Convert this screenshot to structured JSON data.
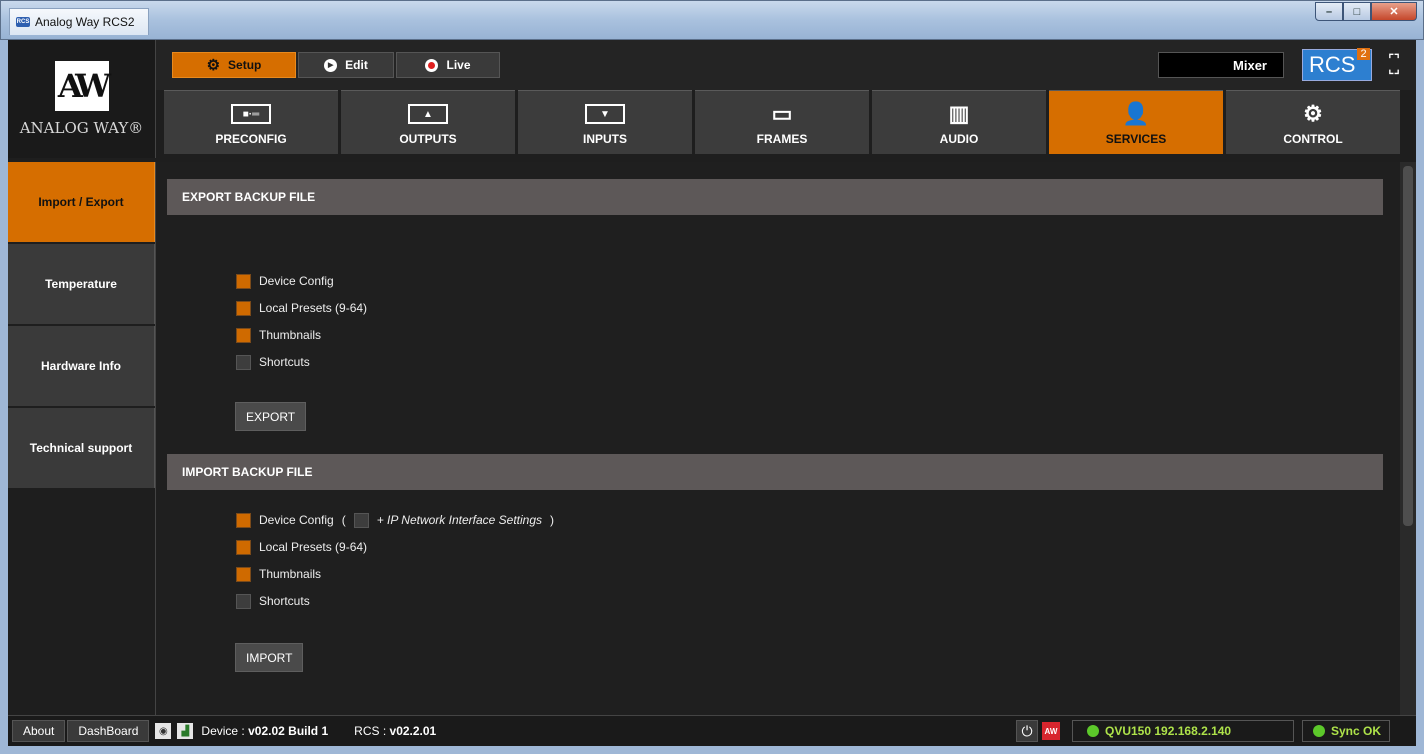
{
  "window": {
    "title": "Analog Way RCS2",
    "icon_text": "RCS",
    "controls": [
      "–",
      "□",
      "✕"
    ]
  },
  "logo": {
    "mark": "AW",
    "brand": "ANALOG WAY®"
  },
  "modes": [
    {
      "label": "Setup",
      "icon": "gear-icon"
    },
    {
      "label": "Edit",
      "icon": "play-icon"
    },
    {
      "label": "Live",
      "icon": "record-icon"
    }
  ],
  "mixer_label": "Mixer",
  "rcs_badge": {
    "text": "RCS",
    "sup": "2"
  },
  "tabs": [
    {
      "label": "PRECONFIG",
      "icon": "preconfig-icon",
      "glyph": "■·═"
    },
    {
      "label": "OUTPUTS",
      "icon": "outputs-icon",
      "glyph": "▲"
    },
    {
      "label": "INPUTS",
      "icon": "inputs-icon",
      "glyph": "▼"
    },
    {
      "label": "FRAMES",
      "icon": "frames-icon",
      "glyph": "▭"
    },
    {
      "label": "AUDIO",
      "icon": "audio-icon",
      "glyph": "▥"
    },
    {
      "label": "SERVICES",
      "icon": "services-icon",
      "glyph": "👤"
    },
    {
      "label": "CONTROL",
      "icon": "control-icon",
      "glyph": "⚙"
    }
  ],
  "sidebar": [
    {
      "label": "Import / Export"
    },
    {
      "label": "Temperature"
    },
    {
      "label": "Hardware Info"
    },
    {
      "label": "Technical support"
    }
  ],
  "export": {
    "header": "EXPORT BACKUP FILE",
    "options": [
      {
        "label": "Device Config",
        "checked": true
      },
      {
        "label": "Local Presets (9-64)",
        "checked": true
      },
      {
        "label": "Thumbnails",
        "checked": true
      },
      {
        "label": "Shortcuts",
        "checked": false
      }
    ],
    "button": "EXPORT"
  },
  "import": {
    "header": "IMPORT BACKUP FILE",
    "options": [
      {
        "label": "Device Config",
        "checked": true
      },
      {
        "label": "Local Presets (9-64)",
        "checked": true
      },
      {
        "label": "Thumbnails",
        "checked": true
      },
      {
        "label": "Shortcuts",
        "checked": false
      }
    ],
    "ip_option": {
      "open": "(",
      "label": "+ IP Network Interface Settings",
      "close": ")",
      "checked": false
    },
    "button": "IMPORT"
  },
  "statusbar": {
    "about": "About",
    "dashboard": "DashBoard",
    "device_prefix": "Device :",
    "device_version": "v02.02 Build 1",
    "rcs_prefix": "RCS :",
    "rcs_version": "v02.2.01",
    "aw_badge": "AW",
    "device_status": "QVU150  192.168.2.140",
    "sync_status": "Sync OK"
  }
}
